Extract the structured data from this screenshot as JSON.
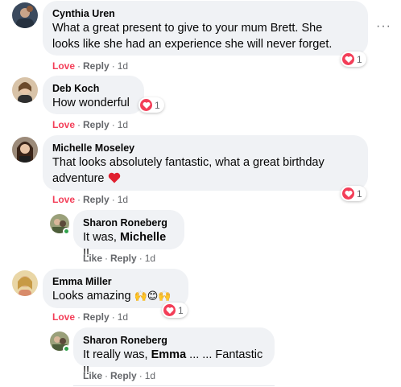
{
  "colors": {
    "love": "#f33e58",
    "bubble": "#f0f2f5",
    "online": "#31a24c",
    "meta": "#65676b"
  },
  "comments": [
    {
      "author": "Cynthia Uren",
      "text_line1": "What a great present to give to your mum Brett. She",
      "text_line2": "looks like she had an experience she will never forget.",
      "reaction_label": "Love",
      "reply_label": "Reply",
      "time": "1d",
      "reaction_count": "1"
    },
    {
      "author": "Deb Koch",
      "text": "How wonderful",
      "reaction_label": "Love",
      "reply_label": "Reply",
      "time": "1d",
      "reaction_count": "1"
    },
    {
      "author": "Michelle Moseley",
      "text_line1": "That looks absolutely fantastic, what a great birthday",
      "text_line2": "adventure",
      "reaction_label": "Love",
      "reply_label": "Reply",
      "time": "1d",
      "reaction_count": "1",
      "reply": {
        "author": "Sharon Roneberg",
        "text_prefix": "It was, ",
        "mention": "Michelle",
        "text_suffix": " !!",
        "like_label": "Like",
        "reply_label": "Reply",
        "time": "1d"
      }
    },
    {
      "author": "Emma Miller",
      "text": "Looks amazing",
      "emojis": "🙌😊🙌",
      "reaction_label": "Love",
      "reply_label": "Reply",
      "time": "1d",
      "reaction_count": "1",
      "reply": {
        "author": "Sharon Roneberg",
        "text_prefix": "It really was, ",
        "mention": "Emma",
        "text_suffix": " ... ... Fantastic !!",
        "like_label": "Like",
        "reply_label": "Reply",
        "time": "1d"
      }
    }
  ],
  "more_icon": "···"
}
